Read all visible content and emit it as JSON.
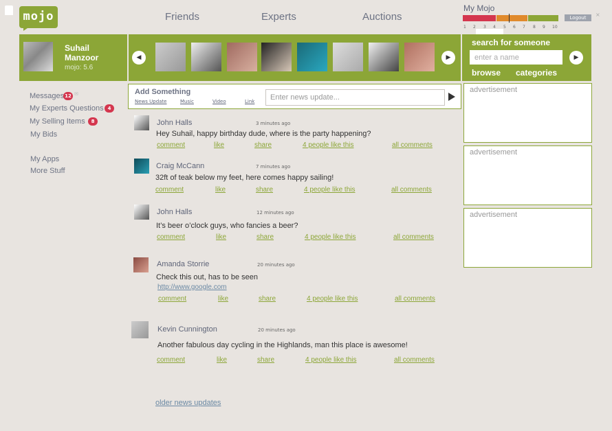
{
  "brand": {
    "logo_text": "mojo"
  },
  "nav": {
    "friends": "Friends",
    "experts": "Experts",
    "auctions": "Auctions"
  },
  "my_mojo": {
    "label": "My Mojo",
    "scale": [
      "1",
      "2",
      "3",
      "4",
      "5",
      "6",
      "7",
      "8",
      "9",
      "10"
    ],
    "logout_label": "Logout",
    "colors": {
      "low": "#d4364e",
      "mid": "#e08a2c",
      "high": "#8ca637"
    }
  },
  "profile": {
    "name_line1": "Suhail",
    "name_line2": "Manzoor",
    "score": "mojo: 5.6"
  },
  "carousel": {
    "prev_icon": "arrow-left-icon",
    "next_icon": "arrow-right-icon"
  },
  "search": {
    "title": "search for someone",
    "placeholder": "enter a name",
    "browse": "browse",
    "categories": "categories"
  },
  "left_menu": {
    "messages": "Messages",
    "messages_count": "12",
    "experts_questions": "My Experts Questions",
    "experts_count": "4",
    "selling_items": "My Selling Items",
    "selling_count": "8",
    "bids": "My Bids",
    "apps": "My Apps",
    "more_stuff": "More Stuff"
  },
  "add_something": {
    "title": "Add Something",
    "tabs": [
      "News Update",
      "Music",
      "Video",
      "Link"
    ],
    "placeholder": "Enter news update..."
  },
  "feed": [
    {
      "name": "John Halls",
      "time": "3 minutes ago",
      "text": "Hey Suhail, happy birthday dude, where is the party happening?"
    },
    {
      "name": "Craig McCann",
      "time": "7 minutes ago",
      "text": "32ft of teak below my feet, here comes happy sailing!"
    },
    {
      "name": "John Halls",
      "time": "12 minutes ago",
      "text": "It’s beer o’clock guys, who fancies a beer?"
    },
    {
      "name": "Amanda Storrie",
      "time": "20 minutes ago",
      "text": "Check this out, has to be seen",
      "link": "http://www.google.com"
    },
    {
      "name": "Kevin Cunnington",
      "time": "20 minutes ago",
      "text": "Another fabulous day cycling in the Highlands, man this place is awesome!"
    }
  ],
  "actions": {
    "comment": "comment",
    "like": "like",
    "share": "share",
    "likes": "4 people like this",
    "all_comments": "all comments"
  },
  "older_updates": "older news updates",
  "ads": [
    "advertisement",
    "advertisement",
    "advertisement"
  ]
}
